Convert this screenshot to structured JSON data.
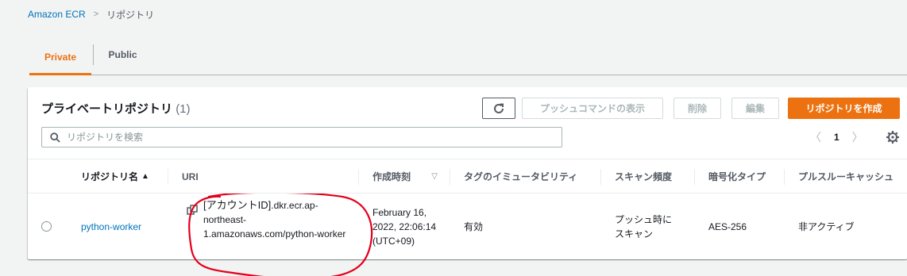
{
  "breadcrumb": {
    "root": "Amazon ECR",
    "current": "リポジトリ"
  },
  "tabs": [
    {
      "label": "Private",
      "active": true
    },
    {
      "label": "Public",
      "active": false
    }
  ],
  "panel": {
    "title": "プライベートリポジトリ",
    "count": "(1)",
    "buttons": {
      "push": "プッシュコマンドの表示",
      "delete": "削除",
      "edit": "編集",
      "create": "リポジトリを作成"
    },
    "search_placeholder": "リポジトリを検索",
    "pager": {
      "page": "1",
      "prev": "〈",
      "next": "〉"
    }
  },
  "table": {
    "columns": [
      "リポジトリ名",
      "URI",
      "作成時刻",
      "タグのイミュータビリティ",
      "スキャン頻度",
      "暗号化タイプ",
      "プルスルーキャッシュ"
    ],
    "rows": [
      {
        "name": "python-worker",
        "uri_account": "[アカウントID]",
        "uri_rest": ".dkr.ecr.ap-northeast-1.amazonaws.com/python-worker",
        "created": "February 16, 2022, 22:06:14 (UTC+09)",
        "immutability": "有効",
        "scan": "プッシュ時にスキャン",
        "encryption": "AES-256",
        "pull_through": "非アクティブ"
      }
    ]
  },
  "icons": {
    "refresh": "refresh-icon",
    "search": "search-icon",
    "settings": "gear-icon",
    "copy": "copy-icon"
  },
  "colors": {
    "accent": "#ec7211",
    "link": "#0073bb",
    "annotation": "#e3001b"
  }
}
